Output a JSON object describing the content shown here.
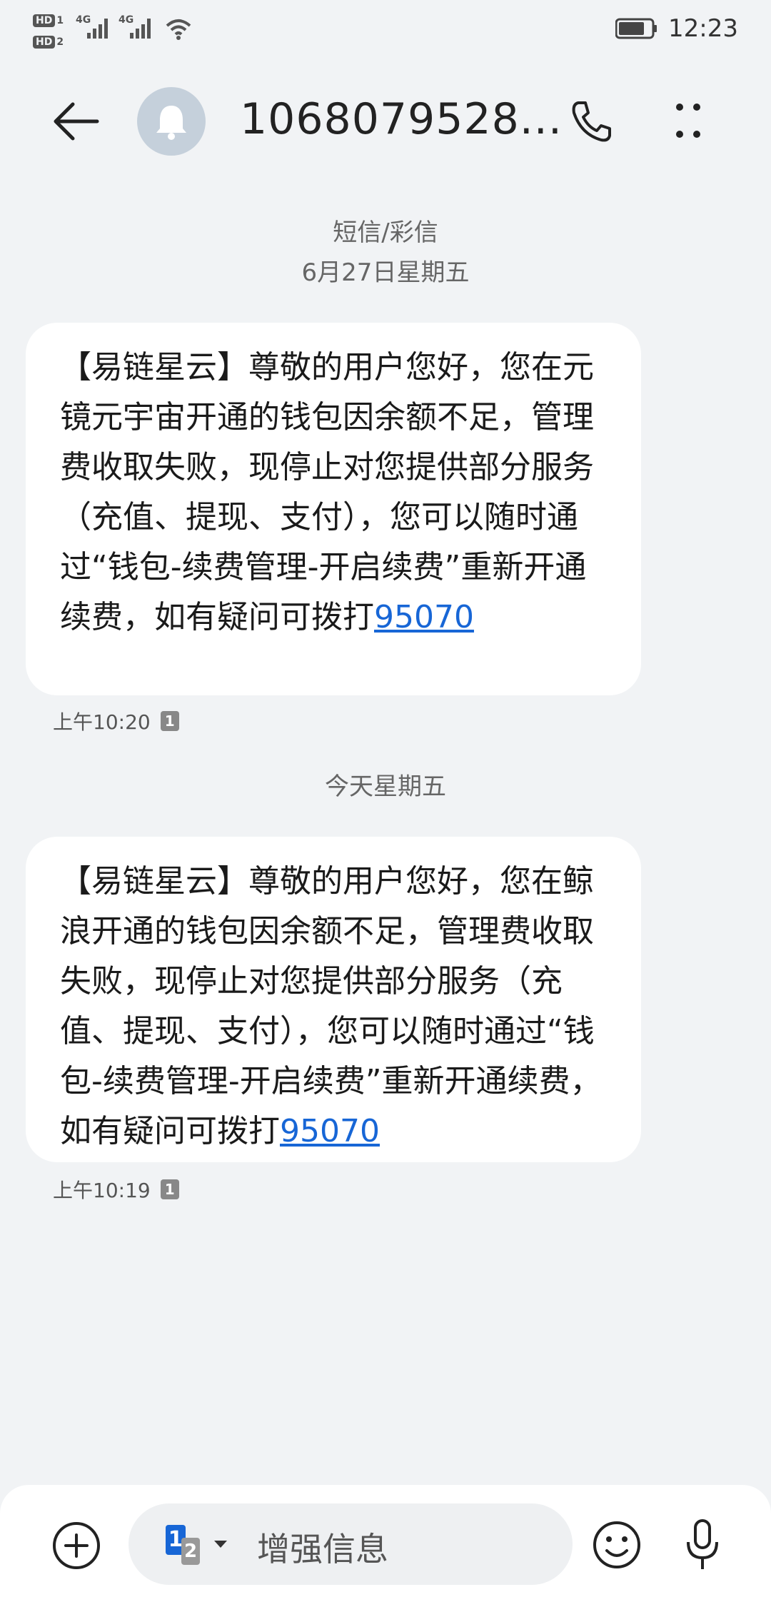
{
  "status_bar": {
    "sim1_badge": "HD",
    "sim1_num": "1",
    "sim2_badge": "HD",
    "sim2_num": "2",
    "net1": "4G",
    "net2": "4G",
    "time": "12:23",
    "battery_level": 0.8
  },
  "header": {
    "contact": "1068079528...",
    "icons": [
      "back-arrow-icon",
      "bell-icon",
      "phone-icon",
      "more-icon"
    ]
  },
  "thread": {
    "channel_label": "短信/彩信",
    "first_date": "6月27日星期五",
    "second_date": "今天星期五"
  },
  "messages": [
    {
      "text": "【易链星云】尊敬的用户您好，您在元镜元宇宙开通的钱包因余额不足，管理费收取失败，现停止对您提供部分服务（充值、提现、支付），您可以随时通过“钱包-续费管理-开启续费”重新开通续费，如有疑问可拨打",
      "link": "95070",
      "time": "上午10:20",
      "sim": "1"
    },
    {
      "text": "【易链星云】尊敬的用户您好，您在鲸浪开通的钱包因余额不足，管理费收取失败，现停止对您提供部分服务（充值、提现、支付），您可以随时通过“钱包-续费管理-开启续费”重新开通续费，如有疑问可拨打",
      "link": "95070",
      "time": "上午10:19",
      "sim": "1"
    }
  ],
  "composer": {
    "placeholder": "增强信息",
    "sim_primary": "1",
    "sim_secondary": "2",
    "accent": "#1766d6"
  }
}
